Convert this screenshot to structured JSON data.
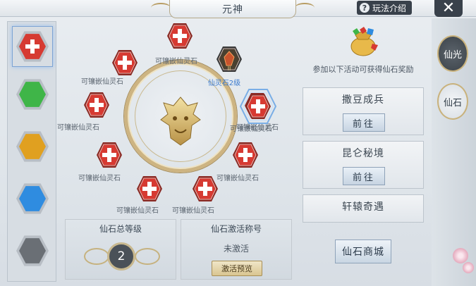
{
  "title": "元神",
  "help_label": "玩法介绍",
  "close_symbol": "✕",
  "side_gems": [
    {
      "name": "red",
      "color": "#d63a32"
    },
    {
      "name": "green",
      "color": "#3fb548"
    },
    {
      "name": "yellow",
      "color": "#e0a020"
    },
    {
      "name": "blue",
      "color": "#2f8ce0"
    },
    {
      "name": "gray",
      "color": "#6a6f75"
    }
  ],
  "ring_slots": [
    {
      "label": "可镶嵌仙灵石"
    },
    {
      "label": "可镶嵌仙灵石"
    },
    {
      "label": "仙灵石2级",
      "level": "II"
    },
    {
      "label": "可镶嵌仙灵石"
    },
    {
      "label": "可镶嵌仙灵石"
    },
    {
      "label": "可镶嵌仙灵石"
    },
    {
      "label": "可镶嵌仙灵石"
    },
    {
      "label": "可镶嵌仙灵石"
    },
    {
      "label": "可镶嵌仙灵石"
    },
    {
      "label": "可镶嵌仙灵石"
    }
  ],
  "total_level": {
    "title": "仙石总等级",
    "value": "2"
  },
  "title_box": {
    "title": "仙石激活称号",
    "status": "未激活",
    "preview_label": "激活预览"
  },
  "rewards_hint": "参加以下活动可获得仙石奖励",
  "activities": [
    {
      "name": "撒豆成兵",
      "button": "前往"
    },
    {
      "name": "昆仑秘境",
      "button": "前往"
    },
    {
      "name": "轩辕奇遇",
      "button": ""
    }
  ],
  "shop_label": "仙石商城",
  "edge_tabs": [
    {
      "label": "仙光",
      "active": true
    },
    {
      "label": "仙石",
      "active": false
    }
  ]
}
